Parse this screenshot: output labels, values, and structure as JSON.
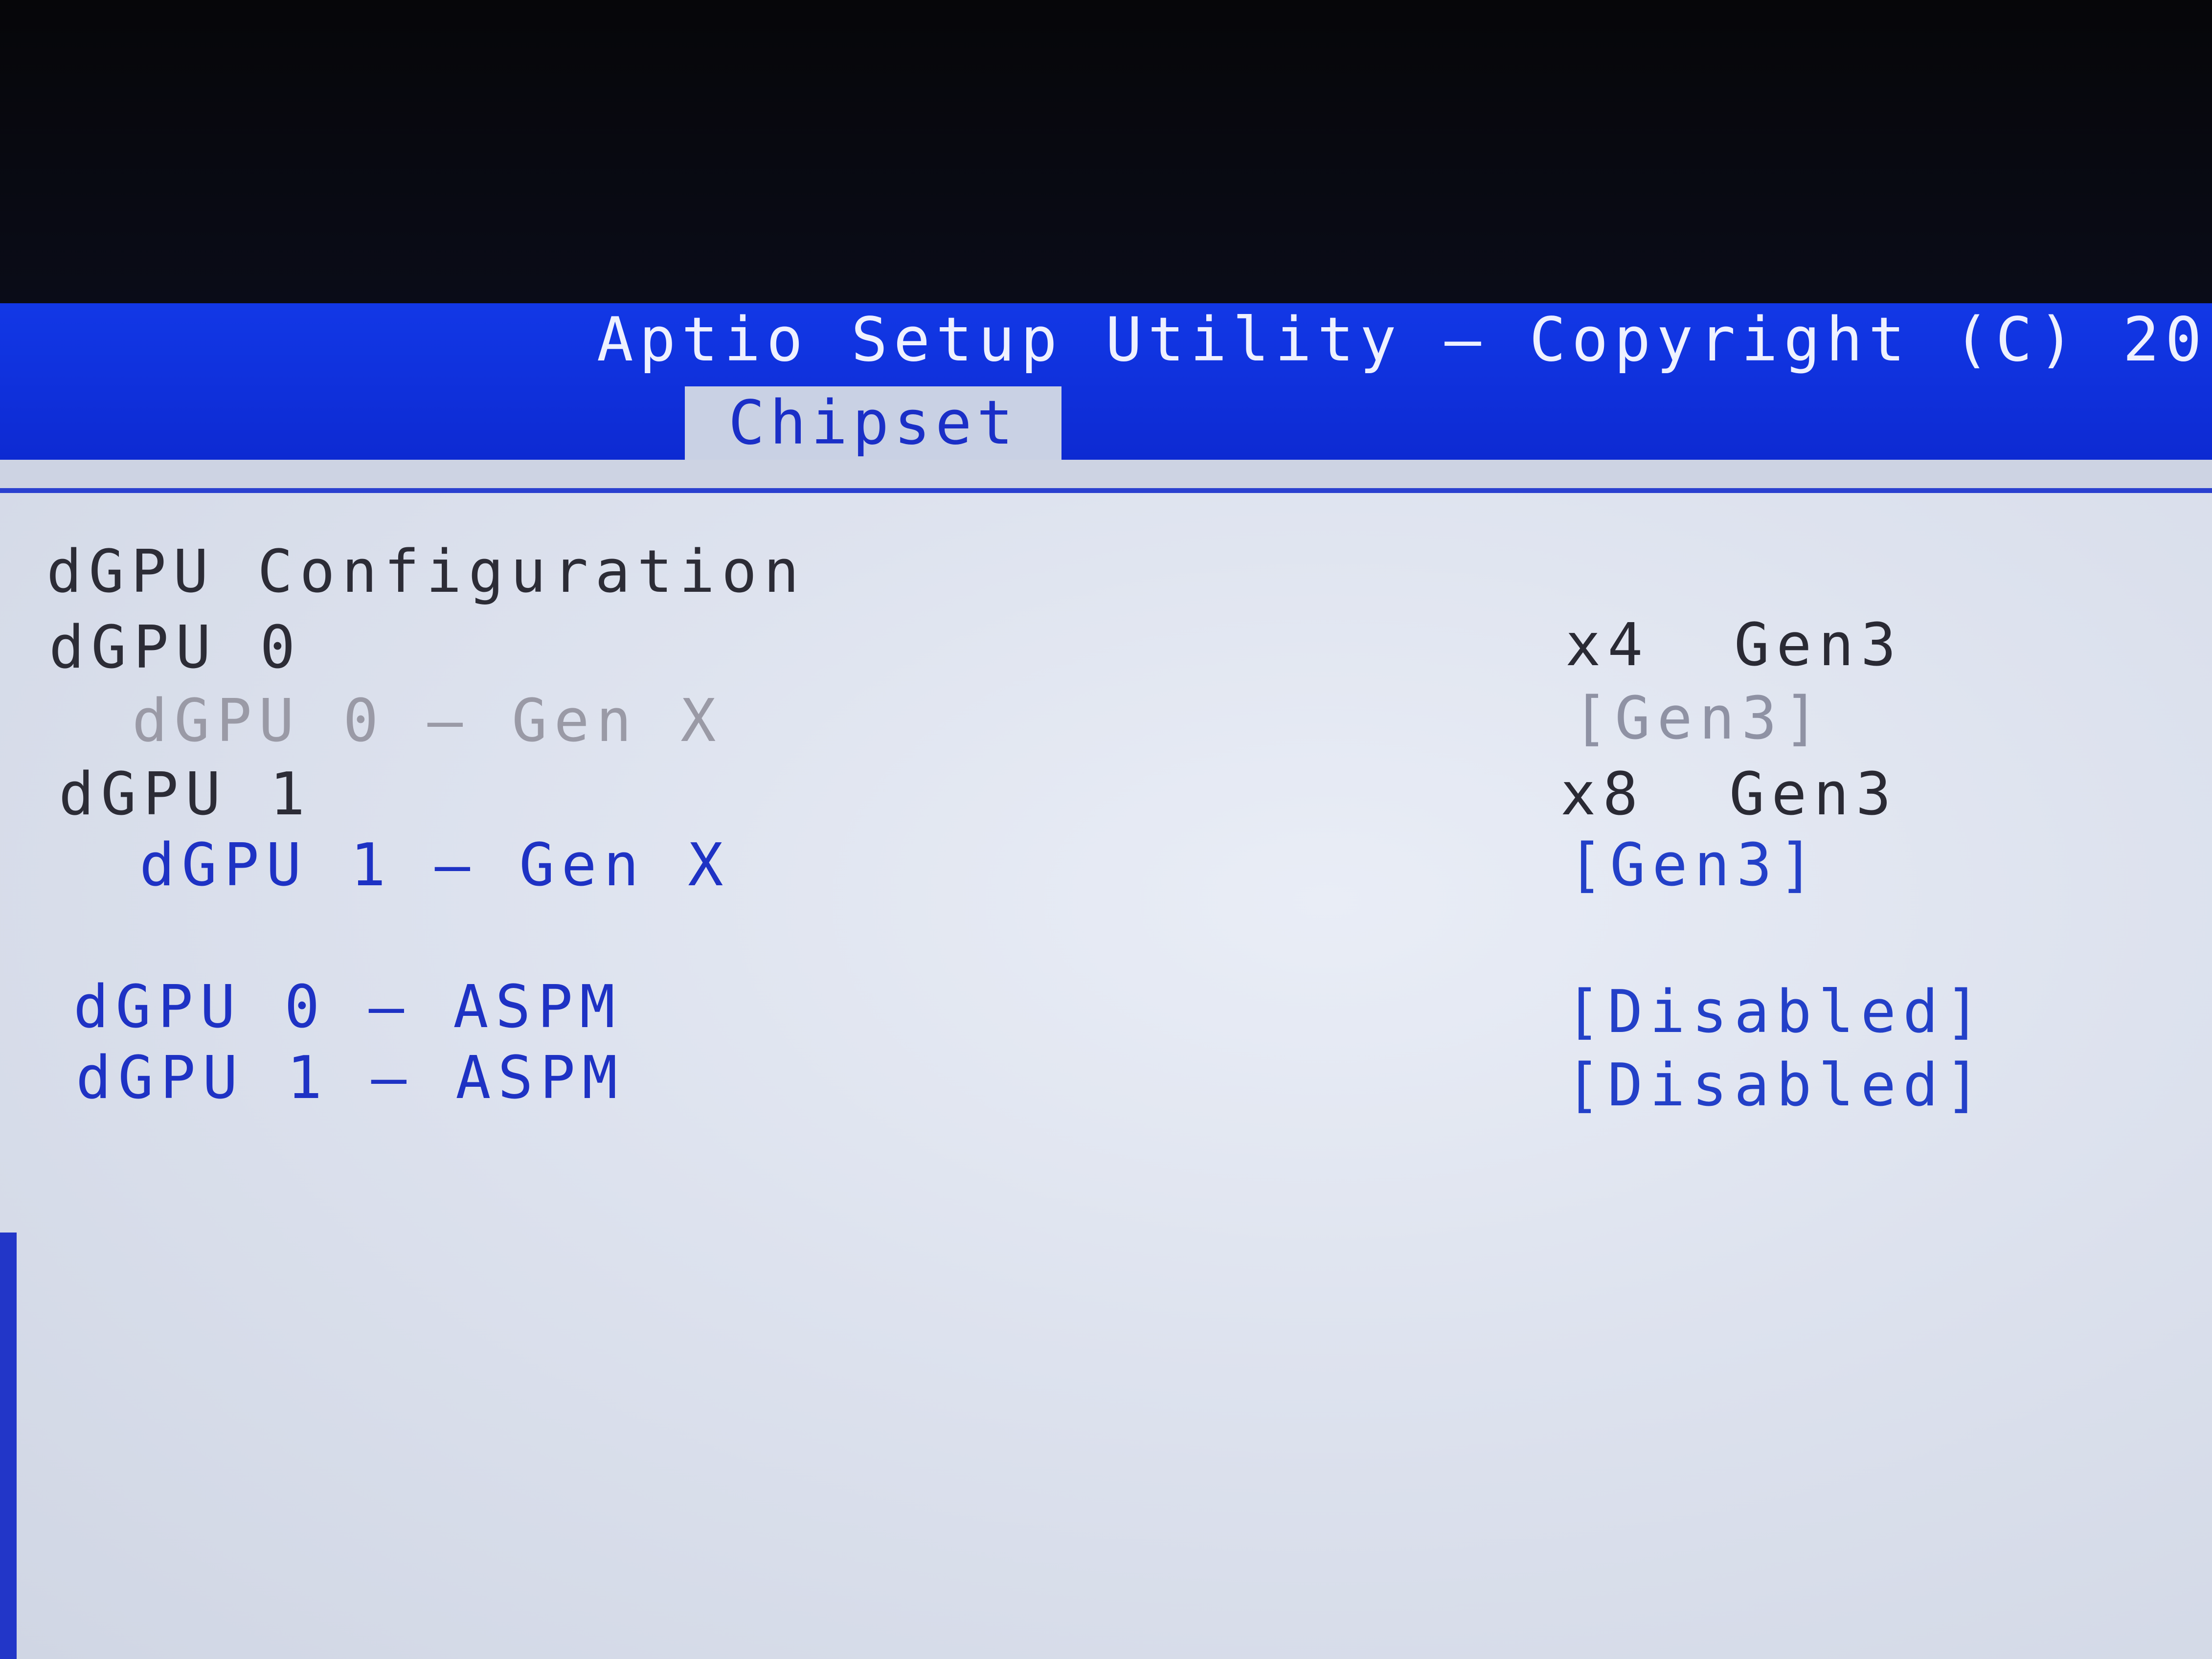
{
  "header": {
    "title": "Aptio Setup Utility – Copyright (C) 20",
    "active_tab": "Chipset"
  },
  "panel": {
    "section_title": "dGPU Configuration",
    "items": [
      {
        "label": "dGPU 0",
        "value": "x4  Gen3"
      },
      {
        "label": "dGPU 0 – Gen X",
        "value": "[Gen3]"
      },
      {
        "label": "dGPU 1",
        "value": "x8  Gen3"
      },
      {
        "label": "dGPU 1 – Gen X",
        "value": "[Gen3]"
      },
      {
        "label": "dGPU 0 – ASPM",
        "value": "[Disabled]"
      },
      {
        "label": "dGPU 1 – ASPM",
        "value": "[Disabled]"
      }
    ]
  },
  "colors": {
    "header_blue": "#1238e6",
    "panel_gray": "#dde2ee",
    "selectable_blue": "#1e32c4",
    "disabled_gray": "#9a9aa6"
  }
}
